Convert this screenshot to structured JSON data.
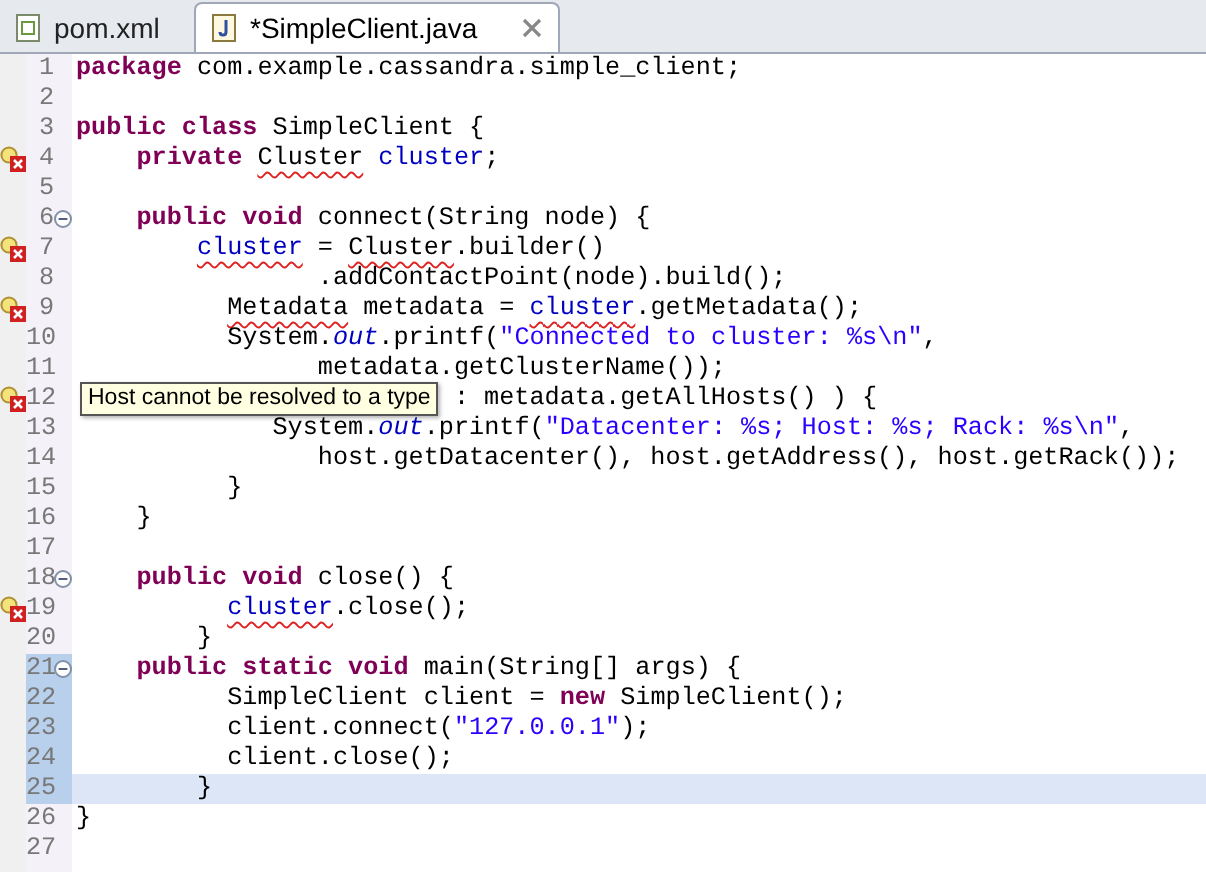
{
  "tabs": [
    {
      "label": "pom.xml",
      "selected": false
    },
    {
      "label": "*SimpleClient.java",
      "selected": true
    }
  ],
  "editor": {
    "lines": [
      {
        "number": "1",
        "kind": "plain",
        "current": false,
        "changed": false,
        "segments": [
          {
            "text": "package",
            "kind": "keyword"
          },
          {
            "text": " com.example.cassandra.simple_client;",
            "kind": "plain"
          }
        ]
      },
      {
        "number": "2",
        "kind": "plain",
        "current": false,
        "changed": false
      },
      {
        "number": "3",
        "kind": "plain",
        "current": false,
        "changed": false,
        "segments": [
          {
            "text": "public class",
            "kind": "keyword"
          },
          {
            "text": " SimpleClient {",
            "kind": "plain"
          }
        ]
      },
      {
        "number": "4",
        "kind": "error",
        "current": false,
        "changed": false,
        "segments": [
          {
            "text": "    private",
            "kind": "keyword"
          },
          {
            "text": " Cluster",
            "kind": "type-error"
          },
          {
            "text": " cluster",
            "kind": "field"
          },
          {
            "text": ";",
            "kind": "plain"
          }
        ]
      },
      {
        "number": "5",
        "kind": "plain",
        "current": false,
        "changed": false
      },
      {
        "number": "6",
        "kind": "fold",
        "current": false,
        "changed": false,
        "segments": [
          {
            "text": "    public void",
            "kind": "keyword"
          },
          {
            "text": " connect(String node) {",
            "kind": "plain"
          }
        ]
      },
      {
        "number": "7",
        "kind": "error",
        "current": false,
        "changed": false,
        "segments": [
          {
            "text": "        cluster",
            "kind": "field-error"
          },
          {
            "text": " = ",
            "kind": "plain"
          },
          {
            "text": "Cluster",
            "kind": "type-error"
          },
          {
            "text": ".builder()",
            "kind": "plain"
          }
        ]
      },
      {
        "number": "8",
        "kind": "plain",
        "current": false,
        "changed": false,
        "segments": [
          {
            "text": "                .addContactPoint(node).build();",
            "kind": "plain"
          }
        ]
      },
      {
        "number": "9",
        "kind": "error",
        "current": false,
        "changed": false,
        "segments": [
          {
            "text": "          Metadata",
            "kind": "type-error"
          },
          {
            "text": " metadata = ",
            "kind": "plain"
          },
          {
            "text": "cluster",
            "kind": "field-error"
          },
          {
            "text": ".getMetadata();",
            "kind": "plain"
          }
        ]
      },
      {
        "number": "10",
        "kind": "plain",
        "current": false,
        "changed": false,
        "segments": [
          {
            "text": "          System.",
            "kind": "plain"
          },
          {
            "text": "out",
            "kind": "static-field"
          },
          {
            "text": ".printf(",
            "kind": "plain"
          },
          {
            "text": "\"Connected to cluster: %s\\n\"",
            "kind": "string"
          },
          {
            "text": ",",
            "kind": "plain"
          }
        ]
      },
      {
        "number": "11",
        "kind": "plain",
        "current": false,
        "changed": false,
        "segments": [
          {
            "text": "                metadata.getClusterName());",
            "kind": "plain"
          }
        ]
      },
      {
        "number": "12",
        "kind": "error",
        "current": false,
        "changed": false,
        "tooltip": "Host cannot be resolved to a type",
        "segments": [
          {
            "text": "                         : metadata.getAllHosts() ) {",
            "kind": "plain"
          }
        ]
      },
      {
        "number": "13",
        "kind": "plain",
        "current": false,
        "changed": false,
        "segments": [
          {
            "text": "             System.",
            "kind": "plain"
          },
          {
            "text": "out",
            "kind": "static-field"
          },
          {
            "text": ".printf(",
            "kind": "plain"
          },
          {
            "text": "\"Datacenter: %s; Host: %s; Rack: %s\\n\"",
            "kind": "string"
          },
          {
            "text": ",",
            "kind": "plain"
          }
        ]
      },
      {
        "number": "14",
        "kind": "plain",
        "current": false,
        "changed": false,
        "segments": [
          {
            "text": "                host.getDatacenter(), host.getAddress(), host.getRack());",
            "kind": "plain"
          }
        ]
      },
      {
        "number": "15",
        "kind": "plain",
        "current": false,
        "changed": false,
        "segments": [
          {
            "text": "          }",
            "kind": "plain"
          }
        ]
      },
      {
        "number": "16",
        "kind": "plain",
        "current": false,
        "changed": false,
        "segments": [
          {
            "text": "    }",
            "kind": "plain"
          }
        ]
      },
      {
        "number": "17",
        "kind": "plain",
        "current": false,
        "changed": false
      },
      {
        "number": "18",
        "kind": "fold",
        "current": false,
        "changed": false,
        "segments": [
          {
            "text": "    public void",
            "kind": "keyword"
          },
          {
            "text": " close() {",
            "kind": "plain"
          }
        ]
      },
      {
        "number": "19",
        "kind": "error",
        "current": false,
        "changed": false,
        "segments": [
          {
            "text": "          cluster",
            "kind": "field-error"
          },
          {
            "text": ".close();",
            "kind": "plain"
          }
        ]
      },
      {
        "number": "20",
        "kind": "plain",
        "current": false,
        "changed": false,
        "segments": [
          {
            "text": "        }",
            "kind": "plain"
          }
        ]
      },
      {
        "number": "21",
        "kind": "fold",
        "current": false,
        "changed": true,
        "segments": [
          {
            "text": "    public static void",
            "kind": "keyword"
          },
          {
            "text": " main(String[] args) {",
            "kind": "plain"
          }
        ]
      },
      {
        "number": "22",
        "kind": "plain",
        "current": false,
        "changed": true,
        "segments": [
          {
            "text": "          SimpleClient client = ",
            "kind": "plain"
          },
          {
            "text": "new",
            "kind": "keyword"
          },
          {
            "text": " SimpleClient();",
            "kind": "plain"
          }
        ]
      },
      {
        "number": "23",
        "kind": "plain",
        "current": false,
        "changed": true,
        "segments": [
          {
            "text": "          client.connect(",
            "kind": "plain"
          },
          {
            "text": "\"127.0.0.1\"",
            "kind": "string"
          },
          {
            "text": ");",
            "kind": "plain"
          }
        ]
      },
      {
        "number": "24",
        "kind": "plain",
        "current": false,
        "changed": true,
        "segments": [
          {
            "text": "          client.close();",
            "kind": "plain"
          }
        ]
      },
      {
        "number": "25",
        "kind": "plain",
        "current": true,
        "changed": true,
        "segments": [
          {
            "text": "        }",
            "kind": "plain"
          }
        ]
      },
      {
        "number": "26",
        "kind": "plain",
        "current": false,
        "changed": false,
        "segments": [
          {
            "text": "}",
            "kind": "plain"
          }
        ]
      },
      {
        "number": "27",
        "kind": "plain",
        "current": false,
        "changed": false
      }
    ]
  }
}
